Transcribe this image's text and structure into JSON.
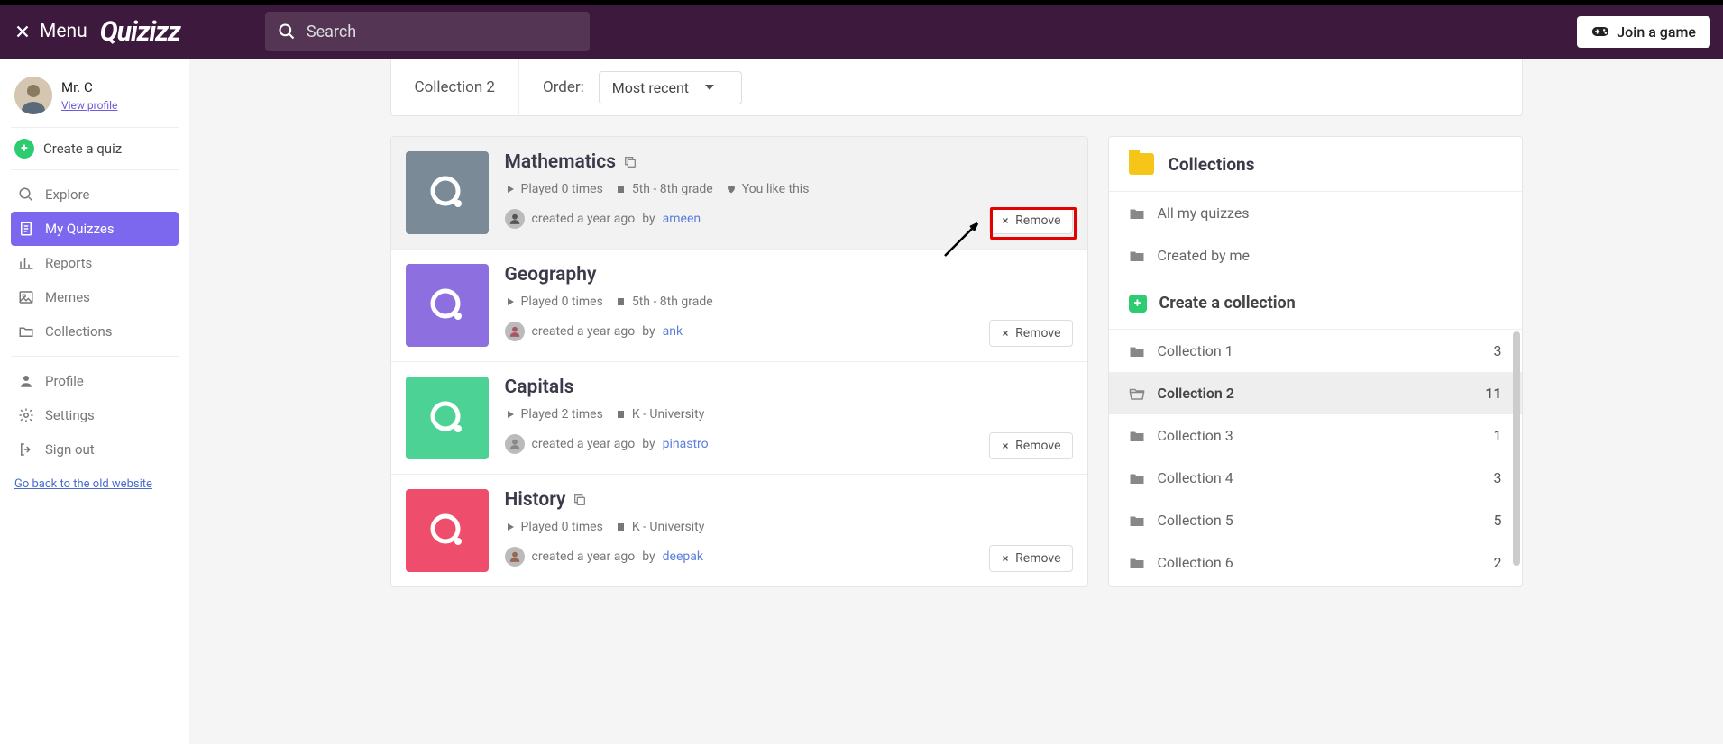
{
  "topbar": {
    "menu": "Menu",
    "logo": "Quizizz",
    "search_placeholder": "Search",
    "join": "Join a game"
  },
  "sidebar": {
    "user_name": "Mr. C",
    "view_profile": "View profile",
    "create_quiz": "Create a quiz",
    "nav": [
      {
        "label": "Explore"
      },
      {
        "label": "My Quizzes"
      },
      {
        "label": "Reports"
      },
      {
        "label": "Memes"
      },
      {
        "label": "Collections"
      }
    ],
    "account": [
      {
        "label": "Profile"
      },
      {
        "label": "Settings"
      },
      {
        "label": "Sign out"
      }
    ],
    "old_site": "Go back to the old website"
  },
  "header": {
    "title": "Collection 2",
    "order_label": "Order:",
    "order_value": "Most recent"
  },
  "quizzes": [
    {
      "title": "Mathematics",
      "has_copy": true,
      "plays": "Played 0 times",
      "grade": "5th - 8th grade",
      "like": "You like this",
      "created": "created a year ago",
      "by": "by",
      "author": "ameen",
      "thumb": "#7b8a97"
    },
    {
      "title": "Geography",
      "has_copy": false,
      "plays": "Played 0 times",
      "grade": "5th - 8th grade",
      "like": "",
      "created": "created a year ago",
      "by": "by",
      "author": "ank",
      "thumb": "#8e6fe0"
    },
    {
      "title": "Capitals",
      "has_copy": false,
      "plays": "Played 2 times",
      "grade": "K - University",
      "like": "",
      "created": "created a year ago",
      "by": "by",
      "author": "pinastro",
      "thumb": "#4dd295"
    },
    {
      "title": "History",
      "has_copy": true,
      "plays": "Played 0 times",
      "grade": "K - University",
      "like": "",
      "created": "created a year ago",
      "by": "by",
      "author": "deepak",
      "thumb": "#ee4e6b"
    }
  ],
  "remove_label": "Remove",
  "side": {
    "title": "Collections",
    "all": "All my quizzes",
    "created": "Created by me",
    "create_collection": "Create a collection",
    "collections": [
      {
        "name": "Collection 1",
        "count": "3"
      },
      {
        "name": "Collection 2",
        "count": "11"
      },
      {
        "name": "Collection 3",
        "count": "1"
      },
      {
        "name": "Collection 4",
        "count": "3"
      },
      {
        "name": "Collection 5",
        "count": "5"
      },
      {
        "name": "Collection 6",
        "count": "2"
      }
    ]
  }
}
